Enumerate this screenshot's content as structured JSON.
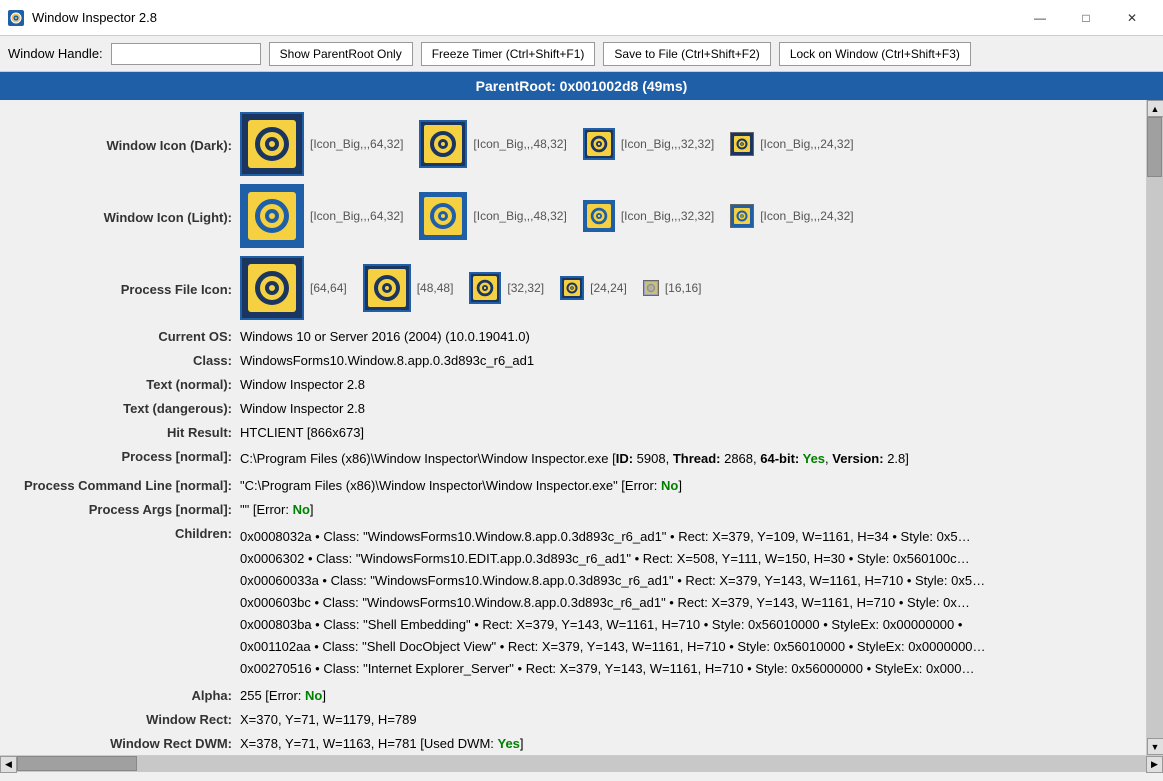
{
  "titleBar": {
    "title": "Window Inspector 2.8",
    "icon": "🔍",
    "minBtn": "—",
    "maxBtn": "□",
    "closeBtn": "✕"
  },
  "toolbar": {
    "handleLabel": "Window Handle:",
    "handleValue": "",
    "btn1": "Show ParentRoot Only",
    "btn2": "Freeze Timer (Ctrl+Shift+F1)",
    "btn3": "Save to File (Ctrl+Shift+F2)",
    "btn4": "Lock on Window (Ctrl+Shift+F3)"
  },
  "banner": {
    "text": "ParentRoot: 0x001002d8 (49ms)"
  },
  "iconRows": {
    "darkLabel": "Window Icon (Dark):",
    "lightLabel": "Window Icon (Light):",
    "processLabel": "Process File Icon:",
    "darkIcons": [
      {
        "size": 64,
        "label": "[Icon_Big,,,64,32]"
      },
      {
        "size": 48,
        "label": "[Icon_Big,,,48,32]"
      },
      {
        "size": 32,
        "label": "[Icon_Big,,,32,32]"
      },
      {
        "size": 24,
        "label": "[Icon_Big,,,24,32]"
      }
    ],
    "lightIcons": [
      {
        "size": 64,
        "label": "[Icon_Big,,,64,32]"
      },
      {
        "size": 48,
        "label": "[Icon_Big,,,48,32]"
      },
      {
        "size": 32,
        "label": "[Icon_Big,,,32,32]"
      },
      {
        "size": 24,
        "label": "[Icon_Big,,,24,32]"
      }
    ],
    "processIcons": [
      {
        "size": 64,
        "label": "[64,64]"
      },
      {
        "size": 48,
        "label": "[48,48]"
      },
      {
        "size": 32,
        "label": "[32,32]"
      },
      {
        "size": 24,
        "label": "[24,24]"
      },
      {
        "size": 16,
        "label": "[16,16]"
      }
    ]
  },
  "fields": {
    "currentOSLabel": "Current OS:",
    "currentOSValue": "Windows 10 or Server 2016 (2004) (10.0.19041.0)",
    "classLabel": "Class:",
    "classValue": "WindowsForms10.Window.8.app.0.3d893c_r6_ad1",
    "textNormalLabel": "Text (normal):",
    "textNormalValue": "Window Inspector 2.8",
    "textDangerousLabel": "Text (dangerous):",
    "textDangerousValue": "Window Inspector 2.8",
    "hitResultLabel": "Hit Result:",
    "hitResultValue": "HTCLIENT [866x673]",
    "processNormalLabel": "Process [normal]:",
    "processNormalPre": "C:\\Program Files (x86)\\Window Inspector\\Window Inspector.exe [",
    "processID": "ID:",
    "processIDVal": "5908,",
    "processThread": "Thread:",
    "processThreadVal": "2868,",
    "process64bit": "64-bit:",
    "process64bitVal": "Yes",
    "processVersion": "Version:",
    "processVersionVal": "2.8]",
    "processCmdLabel": "Process Command Line [normal]:",
    "processCmdValue": "\"\"C:\\Program Files (x86)\\Window Inspector\\Window Inspector.exe\"\" [Error: No]",
    "processArgsLabel": "Process Args [normal]:",
    "processArgsValue": "\"\" [Error: No]",
    "childrenLabel": "Children:",
    "childrenLines": [
      "0x0008032a • Class: \"WindowsForms10.Window.8.app.0.3d893c_r6_ad1\" • Rect: X=379, Y=109, W=1161, H=34 • Style: 0x5(...",
      "0x0006302 • Class: \"WindowsForms10.EDIT.app.0.3d893c_r6_ad1\" • Rect: X=508, Y=111, W=150, H=30 • Style: 0x560100c(...",
      "0x00060033a • Class: \"WindowsForms10.Window.8.app.0.3d893c_r6_ad1\" • Rect: X=379, Y=143, W=1161, H=710 • Style: 0x5(...",
      "0x000603bc • Class: \"WindowsForms10.Window.8.app.0.3d893c_r6_ad1\" • Rect: X=379, Y=143, W=1161, H=710 • Style: 0x(...",
      "0x000803ba • Class: \"Shell Embedding\" • Rect: X=379, Y=143, W=1161, H=710 • Style: 0x56010000 • StyleEx: 0x00000000 •",
      "0x001102aa • Class: \"Shell DocObject View\" • Rect: X=379, Y=143, W=1161, H=710 • Style: 0x56010000 • StyleEx: 0x0000000...",
      "0x00270516 • Class: \"Internet Explorer_Server\" • Rect: X=379, Y=143, W=1161, H=710 • Style: 0x56000000 • StyleEx: 0x000..."
    ],
    "alphaLabel": "Alpha:",
    "alphaValue": "255 [Error: No]",
    "windowRectLabel": "Window Rect:",
    "windowRectValue": "X=370, Y=71, W=1179, H=789",
    "windowRectDWMLabel": "Window Rect DWM:",
    "windowRectDWMValue": "X=378, Y=71, W=1163, H=781 [Used DWM: Yes]",
    "errorNo": "No",
    "errorYes": "Yes",
    "usedDWMYes": "Yes"
  }
}
